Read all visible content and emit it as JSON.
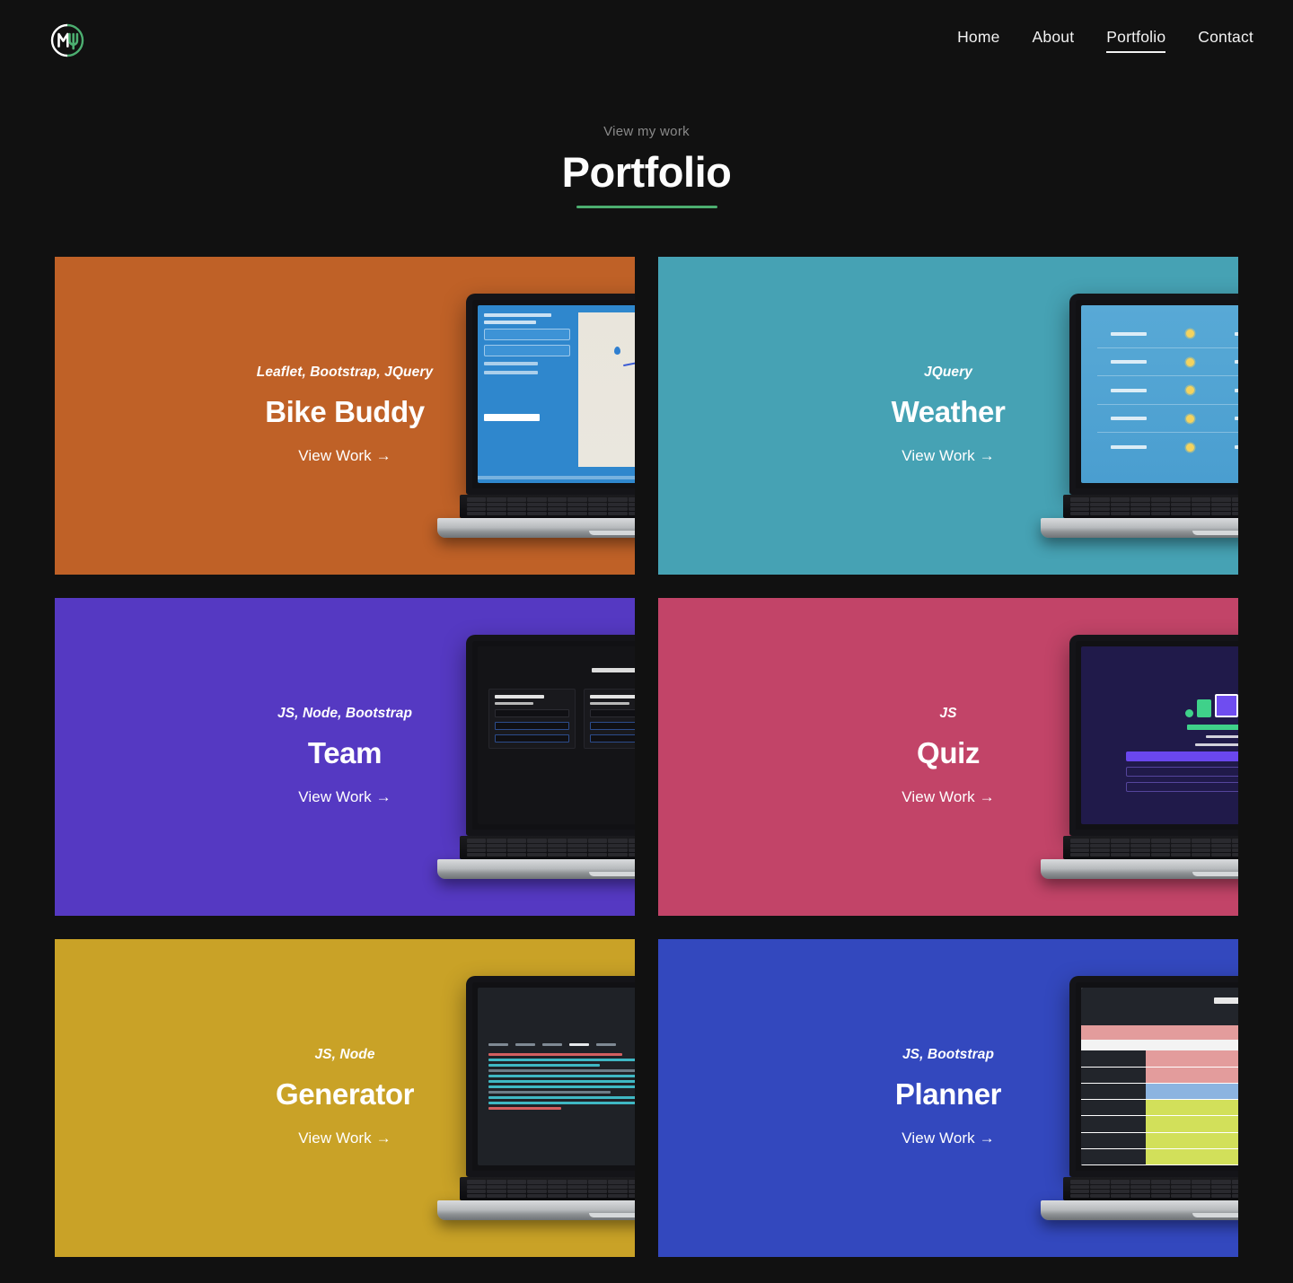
{
  "site": {
    "logo_alt": "ML monogram logo",
    "background_color": "#111111",
    "accent_color": "#4cae70"
  },
  "nav": {
    "items": [
      {
        "label": "Home",
        "active": false
      },
      {
        "label": "About",
        "active": false
      },
      {
        "label": "Portfolio",
        "active": true
      },
      {
        "label": "Contact",
        "active": false
      }
    ]
  },
  "header": {
    "eyebrow": "View my work",
    "title": "Portfolio"
  },
  "projects": [
    {
      "name": "Bike Buddy",
      "tags": "Leaflet, Bootstrap, JQuery",
      "cta": "View Work →",
      "color": "#bf6127",
      "preview": "map-app-screenshot"
    },
    {
      "name": "Weather",
      "tags": "JQuery",
      "cta": "View Work →",
      "color": "#46a2b4",
      "preview": "weather-forecast-screenshot"
    },
    {
      "name": "Team",
      "tags": "JS, Node, Bootstrap",
      "cta": "View Work →",
      "color": "#5539c2",
      "preview": "team-profile-cards-screenshot"
    },
    {
      "name": "Quiz",
      "tags": "JS",
      "cta": "View Work →",
      "color": "#c24468",
      "preview": "coding-quiz-screenshot"
    },
    {
      "name": "Generator",
      "tags": "JS, Node",
      "cta": "View Work →",
      "color": "#c9a227",
      "preview": "terminal-code-screenshot"
    },
    {
      "name": "Planner",
      "tags": "JS, Bootstrap",
      "cta": "View Work →",
      "color": "#3348be",
      "preview": "work-schedule-screenshot"
    }
  ]
}
